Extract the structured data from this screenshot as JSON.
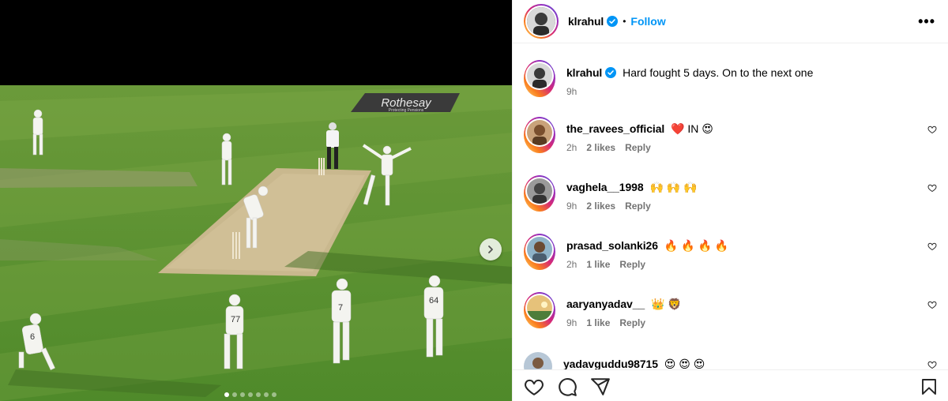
{
  "post": {
    "author": "klrahul",
    "follow_label": "Follow",
    "separator": "•",
    "more_label": "•••",
    "caption": "Hard fought 5 days. On to the next one",
    "caption_time": "9h"
  },
  "media": {
    "billboard_text": "Rothesay",
    "billboard_sub": "Protecting Pensions",
    "carousel": {
      "total": 7,
      "current": 1
    },
    "jersey_numbers": [
      "6",
      "77",
      "7",
      "64"
    ]
  },
  "comments": [
    {
      "user": "the_ravees_official",
      "text": "❤️ IN 😍",
      "time": "2h",
      "likes": "2 likes",
      "reply": "Reply"
    },
    {
      "user": "vaghela__1998",
      "text": "🙌 🙌 🙌",
      "time": "9h",
      "likes": "2 likes",
      "reply": "Reply"
    },
    {
      "user": "prasad_solanki26",
      "text": "🔥 🔥 🔥 🔥",
      "time": "2h",
      "likes": "1 like",
      "reply": "Reply"
    },
    {
      "user": "aaryanyadav__",
      "text": "👑 🦁",
      "time": "9h",
      "likes": "1 like",
      "reply": "Reply"
    },
    {
      "user": "yadavguddu98715",
      "text": "😍 😍 😍",
      "time": "",
      "likes": "",
      "reply": ""
    }
  ],
  "colors": {
    "accent": "#0095f6",
    "muted": "#737373",
    "verified": "#0095f6",
    "heart_red": "#ff3040"
  },
  "icons": [
    "heart-icon",
    "comment-icon",
    "share-icon",
    "bookmark-icon",
    "chevron-right-icon",
    "verified-icon",
    "more-icon"
  ]
}
